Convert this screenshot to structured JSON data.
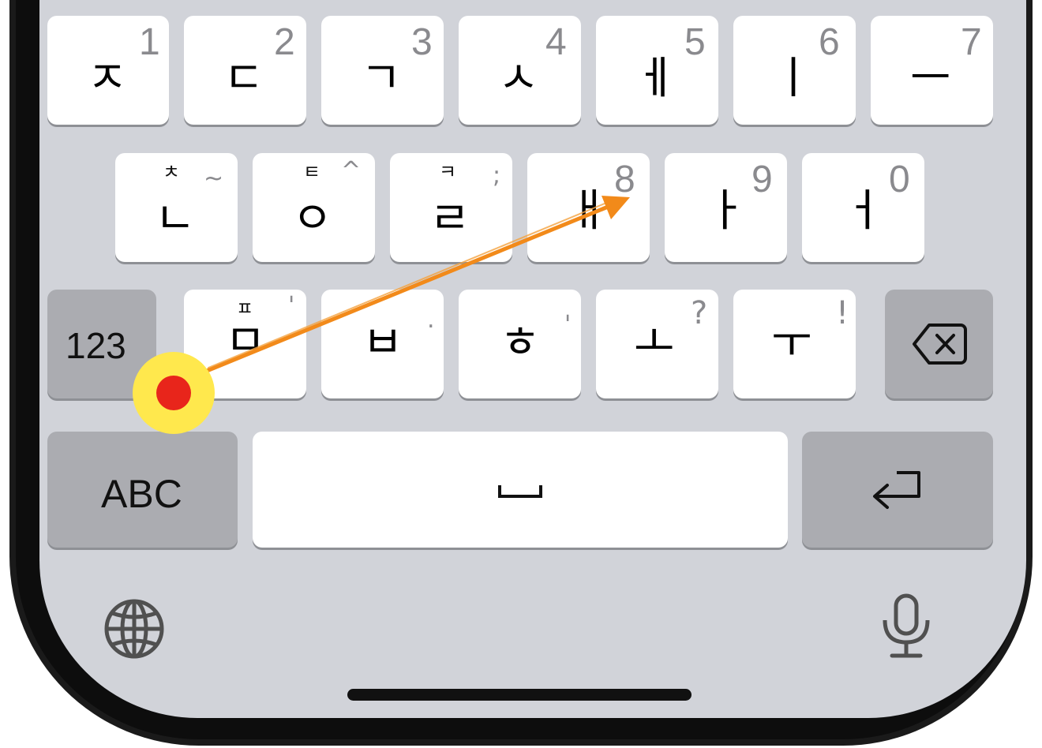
{
  "keyboard": {
    "row1": [
      {
        "main": "ㅈ",
        "num": "1"
      },
      {
        "main": "ㄷ",
        "num": "2"
      },
      {
        "main": "ㄱ",
        "num": "3"
      },
      {
        "main": "ㅅ",
        "num": "4"
      },
      {
        "main": "ㅔ",
        "num": "5"
      },
      {
        "main": "ㅣ",
        "num": "6"
      },
      {
        "main": "ㅡ",
        "num": "7"
      }
    ],
    "row2": [
      {
        "main": "ㄴ",
        "sub": "ㅊ",
        "sym": "~"
      },
      {
        "main": "ㅇ",
        "sub": "ㅌ",
        "sym": "^"
      },
      {
        "main": "ㄹ",
        "sub": "ㅋ",
        "sym": ";"
      },
      {
        "main": "ㅐ",
        "num": "8"
      },
      {
        "main": "ㅏ",
        "num": "9"
      },
      {
        "main": "ㅓ",
        "num": "0"
      }
    ],
    "row3": [
      {
        "main": "ㅁ",
        "sub": "ㅍ",
        "sym": "'"
      },
      {
        "main": "ㅂ",
        "sym": "."
      },
      {
        "main": "ㅎ",
        "sym": "'"
      },
      {
        "main": "ㅗ",
        "sym": "?"
      },
      {
        "main": "ㅜ",
        "sym": "!"
      }
    ],
    "numbers_key": "123",
    "abc_key": "ABC",
    "space_glyph": "␣",
    "delete_icon": "delete-backspace-icon",
    "return_icon": "return-arrow-icon",
    "globe_icon": "globe-icon",
    "mic_icon": "microphone-icon"
  },
  "gesture": {
    "type": "swipe",
    "start_marker_color": "#ffe84d",
    "start_dot_color": "#e8251b",
    "arrow_color": "#f28a1a"
  },
  "colors": {
    "keyboard_bg": "#d1d3d9",
    "key_bg": "#ffffff",
    "function_key_bg": "#abacb1"
  }
}
